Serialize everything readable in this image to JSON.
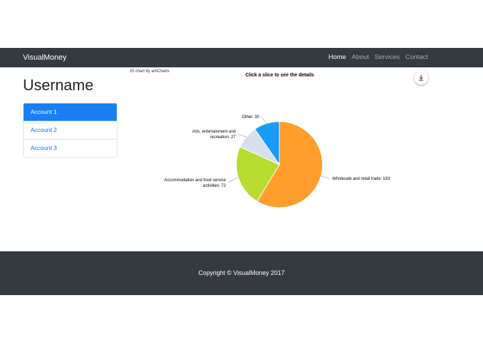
{
  "navbar": {
    "brand": "VisualMoney",
    "links": [
      {
        "label": "Home",
        "active": true
      },
      {
        "label": "About",
        "active": false
      },
      {
        "label": "Services",
        "active": false
      },
      {
        "label": "Contact",
        "active": false
      }
    ]
  },
  "sidebar": {
    "title": "Username",
    "accounts": [
      {
        "label": "Account 1",
        "active": true
      },
      {
        "label": "Account 2",
        "active": false
      },
      {
        "label": "Account 3",
        "active": false
      }
    ]
  },
  "chart_header": {
    "credit": "JS chart by amCharts",
    "title": "Click a slice to see the details",
    "export_icon": "download-icon"
  },
  "chart_data": {
    "type": "pie",
    "title": "Click a slice to see the details",
    "slices": [
      {
        "label": "Wholesale and retail trade",
        "value": 183,
        "color": "#ff9e2c",
        "text": "Wholesale and retail trade: 183"
      },
      {
        "label": "Accommodation and food service activities",
        "value": 72,
        "color": "#b5dc2f",
        "text": "Accommodation and food service activities: 72"
      },
      {
        "label": "Arts, entertainment and recreation",
        "value": 27,
        "color": "#d6e1ed",
        "text": "Arts, entertainment and recreation: 27"
      },
      {
        "label": "Other",
        "value": 30,
        "color": "#1a9bf5",
        "text": "Other: 30"
      }
    ]
  },
  "footer": {
    "text": "Copyright © VisualMoney 2017"
  }
}
